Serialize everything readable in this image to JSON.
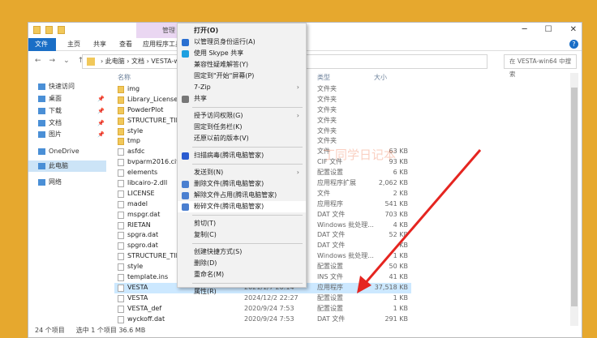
{
  "title": {
    "management_tab": "管理"
  },
  "ribbon": {
    "tabs": [
      "文件",
      "主页",
      "共享",
      "查看",
      "应用程序工具"
    ]
  },
  "nav": {
    "address": "› 此电脑 › 文档 › VESTA-win64",
    "search_placeholder": "在 VESTA-win64 中搜索"
  },
  "sidebar": [
    {
      "label": "快速访问",
      "pin": false
    },
    {
      "label": "桌面",
      "pin": true
    },
    {
      "label": "下载",
      "pin": true
    },
    {
      "label": "文档",
      "pin": true
    },
    {
      "label": "图片",
      "pin": true
    },
    {
      "label": "OneDrive",
      "pin": false
    },
    {
      "label": "此电脑",
      "pin": false,
      "selected": true
    },
    {
      "label": "网络",
      "pin": false
    }
  ],
  "columns": {
    "name": "名称",
    "type": "类型",
    "size": "大小"
  },
  "files": [
    {
      "name": "img",
      "date": "",
      "type": "文件夹",
      "size": "",
      "folder": true
    },
    {
      "name": "Library_License",
      "date": "",
      "type": "文件夹",
      "size": "",
      "folder": true
    },
    {
      "name": "PowderPlot",
      "date": "",
      "type": "文件夹",
      "size": "",
      "folder": true
    },
    {
      "name": "STRUCTURE_TIDY",
      "date": "",
      "type": "文件夹",
      "size": "",
      "folder": true
    },
    {
      "name": "style",
      "date": "",
      "type": "文件夹",
      "size": "",
      "folder": true
    },
    {
      "name": "tmp",
      "date": "",
      "type": "文件夹",
      "size": "",
      "folder": true
    },
    {
      "name": "asfdc",
      "date": "",
      "type": "文件",
      "size": "63 KB"
    },
    {
      "name": "bvparm2016.cif",
      "date": "",
      "type": "CIF 文件",
      "size": "93 KB"
    },
    {
      "name": "elements",
      "date": "",
      "type": "配置设置",
      "size": "6 KB"
    },
    {
      "name": "libcairo-2.dll",
      "date": "",
      "type": "应用程序扩展",
      "size": "2,062 KB"
    },
    {
      "name": "LICENSE",
      "date": "",
      "type": "文件",
      "size": "2 KB"
    },
    {
      "name": "madel",
      "date": "",
      "type": "应用程序",
      "size": "541 KB"
    },
    {
      "name": "mspgr.dat",
      "date": "",
      "type": "DAT 文件",
      "size": "703 KB"
    },
    {
      "name": "RIETAN",
      "date": "",
      "type": "Windows 批处理...",
      "size": "4 KB"
    },
    {
      "name": "spgra.dat",
      "date": "",
      "type": "DAT 文件",
      "size": "52 KB"
    },
    {
      "name": "spgro.dat",
      "date": "",
      "type": "DAT 文件",
      "size": "KB"
    },
    {
      "name": "STRUCTURE_TIDY",
      "date": "",
      "type": "Windows 批处理...",
      "size": "1 KB"
    },
    {
      "name": "style",
      "date": "",
      "type": "配置设置",
      "size": "50 KB"
    },
    {
      "name": "template.ins",
      "date": "",
      "type": "INS 文件",
      "size": "41 KB"
    },
    {
      "name": "VESTA",
      "date": "2021/1/7 20:14",
      "type": "应用程序",
      "size": "37,518 KB",
      "selected": true
    },
    {
      "name": "VESTA",
      "date": "2024/12/2 22:27",
      "type": "配置设置",
      "size": "1 KB"
    },
    {
      "name": "VESTA_def",
      "date": "2020/9/24 7:53",
      "type": "配置设置",
      "size": "1 KB"
    },
    {
      "name": "wyckoff.dat",
      "date": "2020/9/24 7:53",
      "type": "DAT 文件",
      "size": "291 KB"
    }
  ],
  "status": {
    "count": "24 个项目",
    "selected": "选中 1 个项目 36.6 MB"
  },
  "context_menu": [
    {
      "label": "打开(O)",
      "bold": true
    },
    {
      "label": "以管理员身份运行(A)",
      "icon": "shield-icon",
      "color": "#2a6fd0"
    },
    {
      "label": "使用 Skype 共享",
      "icon": "skype-icon",
      "color": "#1ea0e0"
    },
    {
      "label": "兼容性疑难解答(Y)"
    },
    {
      "label": "固定到\"开始\"屏幕(P)"
    },
    {
      "label": "7-Zip",
      "submenu": true
    },
    {
      "label": "共享",
      "icon": "share-icon",
      "color": "#777"
    },
    {
      "sep": true
    },
    {
      "label": "授予访问权限(G)",
      "submenu": true
    },
    {
      "label": "固定到任务栏(K)"
    },
    {
      "label": "还原以前的版本(V)"
    },
    {
      "sep": true
    },
    {
      "label": "扫描病毒(腾讯电脑管家)",
      "icon": "tencent-shield-icon",
      "color": "#2a5bd0"
    },
    {
      "sep": true
    },
    {
      "label": "发送到(N)",
      "submenu": true
    },
    {
      "label": "删除文件(腾讯电脑管家)",
      "icon": "delete-file-icon",
      "color": "#4a7fd0"
    },
    {
      "label": "解除文件占用(腾讯电脑管家)",
      "icon": "unlock-file-icon",
      "color": "#4a7fd0"
    },
    {
      "label": "粉碎文件(腾讯电脑管家)",
      "icon": "shred-file-icon",
      "color": "#4a7fd0",
      "hover": true
    },
    {
      "sep": true
    },
    {
      "label": "剪切(T)"
    },
    {
      "label": "复制(C)"
    },
    {
      "sep": true
    },
    {
      "label": "创建快捷方式(S)"
    },
    {
      "label": "删除(D)"
    },
    {
      "label": "重命名(M)"
    },
    {
      "sep": true
    },
    {
      "label": "属性(R)"
    }
  ],
  "watermark": "丁同学日记本"
}
